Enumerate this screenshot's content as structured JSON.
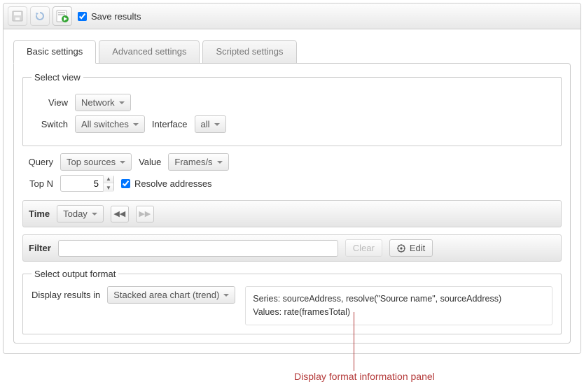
{
  "toolbar": {
    "save_results_label": "Save results",
    "save_results_checked": true
  },
  "tabs": {
    "basic": "Basic settings",
    "advanced": "Advanced settings",
    "scripted": "Scripted settings"
  },
  "select_view": {
    "legend": "Select view",
    "view_label": "View",
    "view_value": "Network",
    "switch_label": "Switch",
    "switch_value": "All switches",
    "interface_label": "Interface",
    "interface_value": "all"
  },
  "query": {
    "query_label": "Query",
    "query_value": "Top sources",
    "value_label": "Value",
    "value_value": "Frames/s",
    "topn_label": "Top N",
    "topn_value": "5",
    "resolve_label": "Resolve addresses",
    "resolve_checked": true
  },
  "time": {
    "title": "Time",
    "value": "Today"
  },
  "filter": {
    "title": "Filter",
    "value": "",
    "clear_label": "Clear",
    "edit_label": "Edit"
  },
  "output": {
    "legend": "Select output format",
    "display_label": "Display results in",
    "display_value": "Stacked area chart (trend)",
    "info_line1": "Series: sourceAddress, resolve(\"Source name\", sourceAddress)",
    "info_line2": "Values: rate(framesTotal)"
  },
  "annotation": "Display format information panel"
}
